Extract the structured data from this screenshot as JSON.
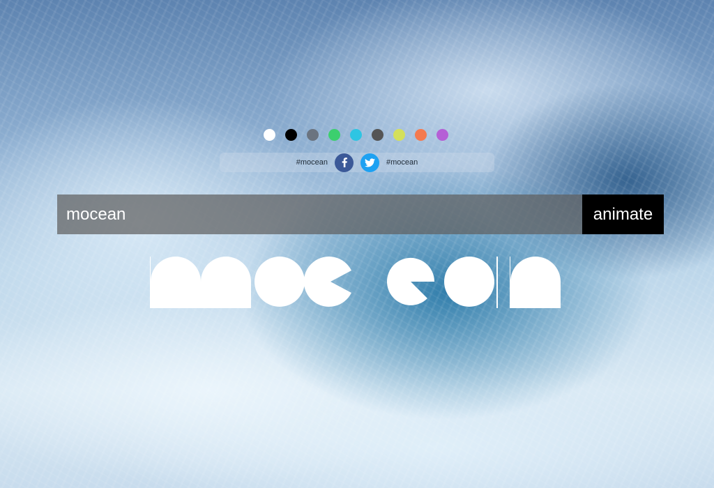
{
  "background": {
    "description_icon": "ocean-wave-background"
  },
  "palette": {
    "swatches": [
      {
        "name": "white",
        "color": "#ffffff"
      },
      {
        "name": "black",
        "color": "#000000"
      },
      {
        "name": "slate",
        "color": "#6b7480"
      },
      {
        "name": "green",
        "color": "#3ccf6e"
      },
      {
        "name": "cyan",
        "color": "#2ec5e3"
      },
      {
        "name": "dark-gray",
        "color": "#555555"
      },
      {
        "name": "lime",
        "color": "#d4e05a"
      },
      {
        "name": "orange",
        "color": "#f57a4f"
      },
      {
        "name": "purple",
        "color": "#b55fd6"
      }
    ]
  },
  "social": {
    "facebook_hashtag": "#mocean",
    "twitter_hashtag": "#mocean",
    "facebook_icon": "facebook-icon",
    "twitter_icon": "twitter-icon",
    "facebook_color": "#3b5998",
    "twitter_color": "#1da1f2"
  },
  "input": {
    "value": "mocean",
    "animate_label": "animate"
  },
  "logo": {
    "text": "mocean",
    "color": "#ffffff"
  }
}
